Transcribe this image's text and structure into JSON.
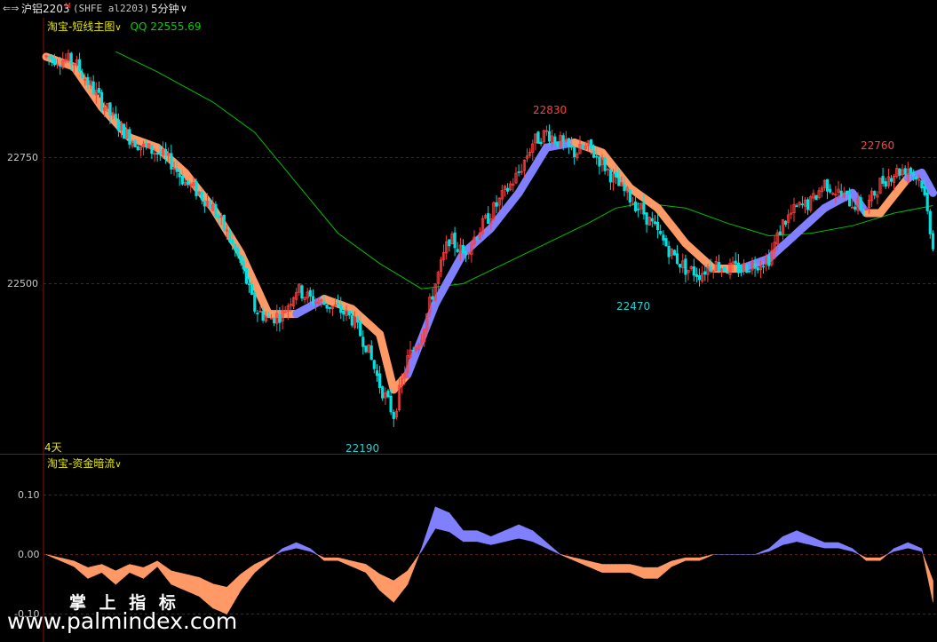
{
  "header": {
    "nav_icon": "back-forward-arrows-icon",
    "symbol": "沪铝2203",
    "symbol_marker": "M",
    "code": "(SHFE al2203)",
    "period": "5分钟",
    "period_chevron": "chevron-down-icon"
  },
  "main_panel": {
    "indicator_name": "淘宝-短线主图",
    "indicator_chevron": "chevron-down-icon",
    "qq_label": "QQ 22555.69",
    "y_ticks": [
      "22750",
      "22500"
    ],
    "days_label": "4天",
    "annotations": {
      "high1": "22830",
      "high2": "22760",
      "low1": "22190",
      "low2": "22470"
    }
  },
  "sub_panel": {
    "indicator_name": "淘宝-资金暗流",
    "indicator_chevron": "chevron-down-icon",
    "y_ticks": [
      "0.10",
      "0.00",
      "-0.10"
    ]
  },
  "watermark": {
    "title": "掌 上 指 标",
    "url": "www.palmindex.com"
  },
  "colors": {
    "up_candle": "#ff3c3c",
    "down_candle": "#00e0e0",
    "ribbon_up": "#8080ff",
    "ribbon_down": "#ff9966",
    "ma_line": "#00c000",
    "grid": "#7a1010",
    "annotation_high": "#ff4040",
    "annotation_low": "#20d0d0"
  },
  "chart_data": {
    "type": "candlestick",
    "y_range": [
      22150,
      22980
    ],
    "path_points": [
      [
        0,
        22950
      ],
      [
        5,
        22945
      ],
      [
        10,
        22940
      ],
      [
        15,
        22900
      ],
      [
        20,
        22860
      ],
      [
        25,
        22820
      ],
      [
        30,
        22790
      ],
      [
        35,
        22770
      ],
      [
        40,
        22760
      ],
      [
        45,
        22740
      ],
      [
        50,
        22700
      ],
      [
        55,
        22680
      ],
      [
        60,
        22650
      ],
      [
        65,
        22600
      ],
      [
        70,
        22540
      ],
      [
        75,
        22450
      ],
      [
        80,
        22430
      ],
      [
        85,
        22440
      ],
      [
        90,
        22490
      ],
      [
        95,
        22470
      ],
      [
        100,
        22460
      ],
      [
        105,
        22450
      ],
      [
        110,
        22430
      ],
      [
        115,
        22380
      ],
      [
        120,
        22300
      ],
      [
        125,
        22240
      ],
      [
        130,
        22350
      ],
      [
        135,
        22400
      ],
      [
        140,
        22500
      ],
      [
        145,
        22590
      ],
      [
        150,
        22560
      ],
      [
        155,
        22600
      ],
      [
        160,
        22640
      ],
      [
        165,
        22680
      ],
      [
        170,
        22720
      ],
      [
        175,
        22780
      ],
      [
        180,
        22800
      ],
      [
        185,
        22780
      ],
      [
        190,
        22760
      ],
      [
        195,
        22770
      ],
      [
        200,
        22740
      ],
      [
        205,
        22700
      ],
      [
        210,
        22670
      ],
      [
        215,
        22640
      ],
      [
        220,
        22600
      ],
      [
        225,
        22560
      ],
      [
        230,
        22530
      ],
      [
        235,
        22520
      ],
      [
        240,
        22540
      ],
      [
        245,
        22530
      ],
      [
        250,
        22530
      ],
      [
        255,
        22540
      ],
      [
        260,
        22550
      ],
      [
        265,
        22620
      ],
      [
        270,
        22650
      ],
      [
        275,
        22660
      ],
      [
        280,
        22700
      ],
      [
        285,
        22680
      ],
      [
        290,
        22660
      ],
      [
        295,
        22650
      ],
      [
        300,
        22700
      ],
      [
        305,
        22720
      ],
      [
        310,
        22730
      ],
      [
        315,
        22700
      ],
      [
        319,
        22580
      ]
    ],
    "ribbon_points": [
      [
        0,
        22950
      ],
      [
        10,
        22930
      ],
      [
        20,
        22850
      ],
      [
        30,
        22790
      ],
      [
        40,
        22770
      ],
      [
        50,
        22720
      ],
      [
        60,
        22650
      ],
      [
        70,
        22560
      ],
      [
        80,
        22440
      ],
      [
        90,
        22440
      ],
      [
        100,
        22470
      ],
      [
        110,
        22450
      ],
      [
        120,
        22400
      ],
      [
        125,
        22290
      ],
      [
        130,
        22320
      ],
      [
        140,
        22460
      ],
      [
        150,
        22560
      ],
      [
        160,
        22610
      ],
      [
        170,
        22680
      ],
      [
        180,
        22770
      ],
      [
        190,
        22780
      ],
      [
        200,
        22760
      ],
      [
        210,
        22690
      ],
      [
        220,
        22650
      ],
      [
        230,
        22580
      ],
      [
        240,
        22530
      ],
      [
        250,
        22530
      ],
      [
        260,
        22550
      ],
      [
        270,
        22600
      ],
      [
        280,
        22650
      ],
      [
        290,
        22680
      ],
      [
        295,
        22640
      ],
      [
        300,
        22640
      ],
      [
        310,
        22710
      ],
      [
        315,
        22720
      ],
      [
        319,
        22680
      ]
    ],
    "ribbon_dir": [
      -1,
      -1,
      -1,
      -1,
      -1,
      -1,
      -1,
      -1,
      -1,
      1,
      -1,
      -1,
      -1,
      -1,
      1,
      1,
      1,
      1,
      1,
      1,
      -1,
      -1,
      -1,
      -1,
      -1,
      -1,
      1,
      1,
      1,
      1,
      1,
      -1,
      -1,
      1,
      1,
      -1
    ],
    "ma_points": [
      [
        25,
        22960
      ],
      [
        40,
        22920
      ],
      [
        60,
        22860
      ],
      [
        75,
        22800
      ],
      [
        90,
        22700
      ],
      [
        105,
        22600
      ],
      [
        120,
        22540
      ],
      [
        135,
        22490
      ],
      [
        150,
        22500
      ],
      [
        165,
        22540
      ],
      [
        180,
        22580
      ],
      [
        195,
        22620
      ],
      [
        205,
        22650
      ],
      [
        215,
        22660
      ],
      [
        230,
        22650
      ],
      [
        245,
        22620
      ],
      [
        260,
        22595
      ],
      [
        275,
        22600
      ],
      [
        290,
        22615
      ],
      [
        305,
        22640
      ],
      [
        319,
        22655
      ]
    ],
    "flow_points": [
      [
        0,
        0.0
      ],
      [
        5,
        -0.01
      ],
      [
        10,
        -0.02
      ],
      [
        15,
        -0.04
      ],
      [
        20,
        -0.03
      ],
      [
        25,
        -0.05
      ],
      [
        30,
        -0.03
      ],
      [
        35,
        -0.04
      ],
      [
        40,
        -0.02
      ],
      [
        45,
        -0.05
      ],
      [
        50,
        -0.06
      ],
      [
        55,
        -0.07
      ],
      [
        60,
        -0.09
      ],
      [
        65,
        -0.1
      ],
      [
        70,
        -0.06
      ],
      [
        75,
        -0.03
      ],
      [
        80,
        -0.01
      ],
      [
        85,
        0.01
      ],
      [
        90,
        0.02
      ],
      [
        95,
        0.01
      ],
      [
        100,
        -0.01
      ],
      [
        105,
        -0.01
      ],
      [
        110,
        -0.02
      ],
      [
        115,
        -0.03
      ],
      [
        120,
        -0.06
      ],
      [
        125,
        -0.08
      ],
      [
        130,
        -0.05
      ],
      [
        135,
        0.01
      ],
      [
        140,
        0.08
      ],
      [
        145,
        0.07
      ],
      [
        150,
        0.04
      ],
      [
        155,
        0.04
      ],
      [
        160,
        0.03
      ],
      [
        165,
        0.04
      ],
      [
        170,
        0.05
      ],
      [
        175,
        0.04
      ],
      [
        180,
        0.02
      ],
      [
        185,
        0.0
      ],
      [
        190,
        -0.01
      ],
      [
        195,
        -0.02
      ],
      [
        200,
        -0.03
      ],
      [
        205,
        -0.03
      ],
      [
        210,
        -0.03
      ],
      [
        215,
        -0.04
      ],
      [
        220,
        -0.04
      ],
      [
        225,
        -0.02
      ],
      [
        230,
        -0.01
      ],
      [
        235,
        -0.01
      ],
      [
        240,
        0.0
      ],
      [
        245,
        0.0
      ],
      [
        250,
        0.0
      ],
      [
        255,
        0.0
      ],
      [
        260,
        0.01
      ],
      [
        265,
        0.03
      ],
      [
        270,
        0.04
      ],
      [
        275,
        0.03
      ],
      [
        280,
        0.02
      ],
      [
        285,
        0.02
      ],
      [
        290,
        0.01
      ],
      [
        295,
        -0.01
      ],
      [
        300,
        -0.01
      ],
      [
        305,
        0.01
      ],
      [
        310,
        0.02
      ],
      [
        315,
        0.01
      ],
      [
        319,
        -0.08
      ]
    ]
  }
}
